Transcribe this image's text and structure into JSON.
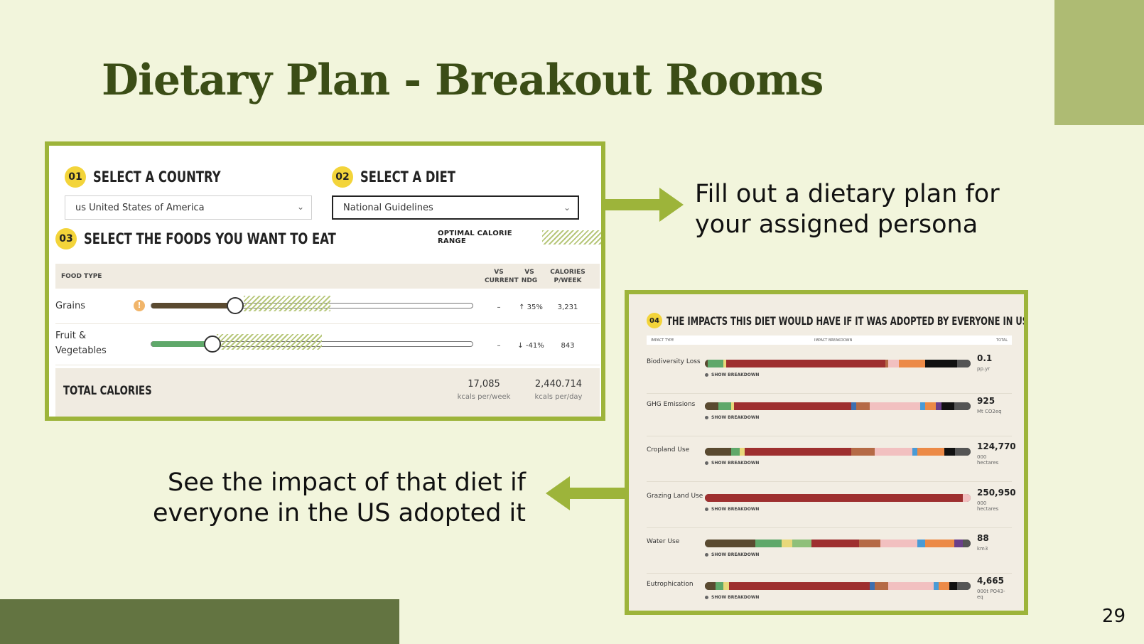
{
  "slide": {
    "title": "Dietary Plan - Breakout Rooms",
    "page_number": "29",
    "caption_right": "Fill out a dietary plan for your assigned persona",
    "caption_left": "See the impact of that diet if everyone in the US adopted it",
    "colors": {
      "background": "#f2f5dc",
      "title": "#3b4d16",
      "accent": "#9db43a",
      "band": "#637441",
      "corner": "#aebb73"
    }
  },
  "planner": {
    "step1": {
      "badge": "01",
      "label": "SELECT A COUNTRY",
      "value": "us United States of America"
    },
    "step2": {
      "badge": "02",
      "label": "SELECT A DIET",
      "value": "National Guidelines"
    },
    "step3": {
      "badge": "03",
      "label": "SELECT THE FOODS YOU WANT TO EAT"
    },
    "optimal_label": "OPTIMAL CALORIE RANGE",
    "columns": {
      "food_type": "FOOD TYPE",
      "vs_current": "VS CURRENT",
      "vs_ndg": "VS NDG",
      "calories": "CALORIES P/WEEK"
    },
    "rows": [
      {
        "label": "Grains",
        "warning": "!",
        "level": 0.26,
        "vs_current": "–",
        "vs_ndg": "↑ 35%",
        "calories": "3,231",
        "color": "#5a4a30"
      },
      {
        "label": "Fruit & Vegetables",
        "warning": "",
        "level": 0.19,
        "vs_current": "–",
        "vs_ndg": "↓ -41%",
        "calories": "843",
        "color": "#5fa86a"
      }
    ],
    "total": {
      "label": "TOTAL CALORIES",
      "week_value": "17,085",
      "week_unit": "kcals per/week",
      "day_value": "2,440.714",
      "day_unit": "kcals per/day"
    }
  },
  "impact": {
    "badge": "04",
    "title": "THE IMPACTS THIS DIET WOULD HAVE IF IT WAS ADOPTED BY EVERYONE IN USA",
    "col_type": "IMPACT TYPE",
    "col_breakdown": "IMPACT BREAKDOWN",
    "col_total": "TOTAL",
    "show_label": "SHOW BREAKDOWN",
    "rows": [
      {
        "label": "Biodiversity Loss",
        "total": "0.1",
        "unit": "pp.yr",
        "segments": [
          [
            "#5a4a30",
            1
          ],
          [
            "#5fa86a",
            6
          ],
          [
            "#e8d87a",
            1
          ],
          [
            "#9e2f2f",
            60
          ],
          [
            "#b56a46",
            1
          ],
          [
            "#f2c0c0",
            4
          ],
          [
            "#ec8a47",
            10
          ],
          [
            "#111111",
            12
          ],
          [
            "#555555",
            5
          ]
        ]
      },
      {
        "label": "GHG Emissions",
        "total": "925",
        "unit": "Mt CO2eq",
        "segments": [
          [
            "#5a4a30",
            5
          ],
          [
            "#5fa86a",
            5
          ],
          [
            "#e8d87a",
            1
          ],
          [
            "#9e2f2f",
            44
          ],
          [
            "#3e6fb0",
            2
          ],
          [
            "#b56a46",
            5
          ],
          [
            "#f2c0c0",
            19
          ],
          [
            "#4a9bd6",
            2
          ],
          [
            "#ec8a47",
            4
          ],
          [
            "#6a3f8a",
            2
          ],
          [
            "#111111",
            5
          ],
          [
            "#555555",
            6
          ]
        ]
      },
      {
        "label": "Cropland Use",
        "total": "124,770",
        "unit": "000 hectares",
        "segments": [
          [
            "#5a4a30",
            10
          ],
          [
            "#5fa86a",
            3
          ],
          [
            "#e8d87a",
            2
          ],
          [
            "#9e2f2f",
            40
          ],
          [
            "#b56a46",
            9
          ],
          [
            "#f2c0c0",
            14
          ],
          [
            "#4a9bd6",
            2
          ],
          [
            "#ec8a47",
            10
          ],
          [
            "#111111",
            4
          ],
          [
            "#555555",
            6
          ]
        ]
      },
      {
        "label": "Grazing Land Use",
        "total": "250,950",
        "unit": "000 hectares",
        "segments": [
          [
            "#9e2f2f",
            97
          ],
          [
            "#f2c0c0",
            3
          ]
        ]
      },
      {
        "label": "Water Use",
        "total": "88",
        "unit": "km3",
        "segments": [
          [
            "#5a4a30",
            19
          ],
          [
            "#5fa86a",
            10
          ],
          [
            "#e8d87a",
            4
          ],
          [
            "#8fc07a",
            7
          ],
          [
            "#9e2f2f",
            18
          ],
          [
            "#b56a46",
            8
          ],
          [
            "#f2c0c0",
            14
          ],
          [
            "#4a9bd6",
            3
          ],
          [
            "#ec8a47",
            11
          ],
          [
            "#6a3f8a",
            3
          ],
          [
            "#555555",
            3
          ]
        ]
      },
      {
        "label": "Eutrophication",
        "total": "4,665",
        "unit": "000t PO43-eq",
        "segments": [
          [
            "#5a4a30",
            4
          ],
          [
            "#5fa86a",
            3
          ],
          [
            "#e8d87a",
            2
          ],
          [
            "#9e2f2f",
            53
          ],
          [
            "#3e6fb0",
            2
          ],
          [
            "#b56a46",
            5
          ],
          [
            "#f2c0c0",
            17
          ],
          [
            "#4a9bd6",
            2
          ],
          [
            "#ec8a47",
            4
          ],
          [
            "#111111",
            3
          ],
          [
            "#555555",
            5
          ]
        ]
      }
    ]
  }
}
